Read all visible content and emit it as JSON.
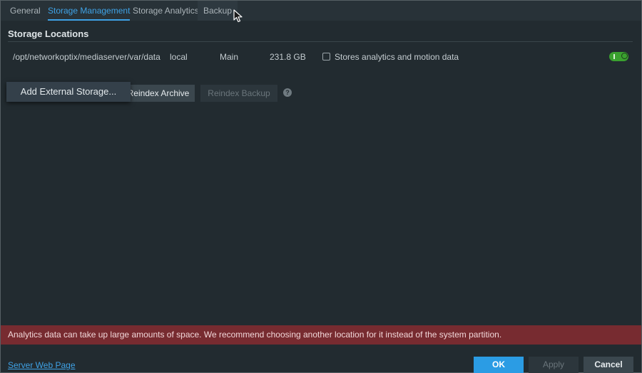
{
  "tabs": [
    {
      "label": "General"
    },
    {
      "label": "Storage Management",
      "active": true
    },
    {
      "label": "Storage Analytics"
    },
    {
      "label": "Backup"
    }
  ],
  "section": {
    "title": "Storage Locations"
  },
  "storage_rows": [
    {
      "path": "/opt/networkoptix/mediaserver/var/data",
      "type": "local",
      "role": "Main",
      "size": "231.8 GB",
      "analytics_label": "Stores analytics and motion data",
      "analytics_checked": false,
      "enabled": true
    }
  ],
  "buttons": {
    "add_external": "Add External Storage...",
    "reindex_archive": "Reindex Archive",
    "reindex_backup": "Reindex Backup"
  },
  "icons": {
    "help": "help-icon",
    "cursor": "arrow-cursor-icon",
    "help_glyph": "?"
  },
  "warning": {
    "text": "Analytics data can take up large amounts of space. We recommend choosing another location for it instead of the system partition."
  },
  "footer": {
    "web_link": "Server Web Page",
    "ok": "OK",
    "apply": "Apply",
    "cancel": "Cancel"
  },
  "colors": {
    "accent": "#3fa2e6",
    "warning_bg": "#772b30",
    "toggle_on": "#3aa12f",
    "ok_button": "#2b9ce4"
  }
}
